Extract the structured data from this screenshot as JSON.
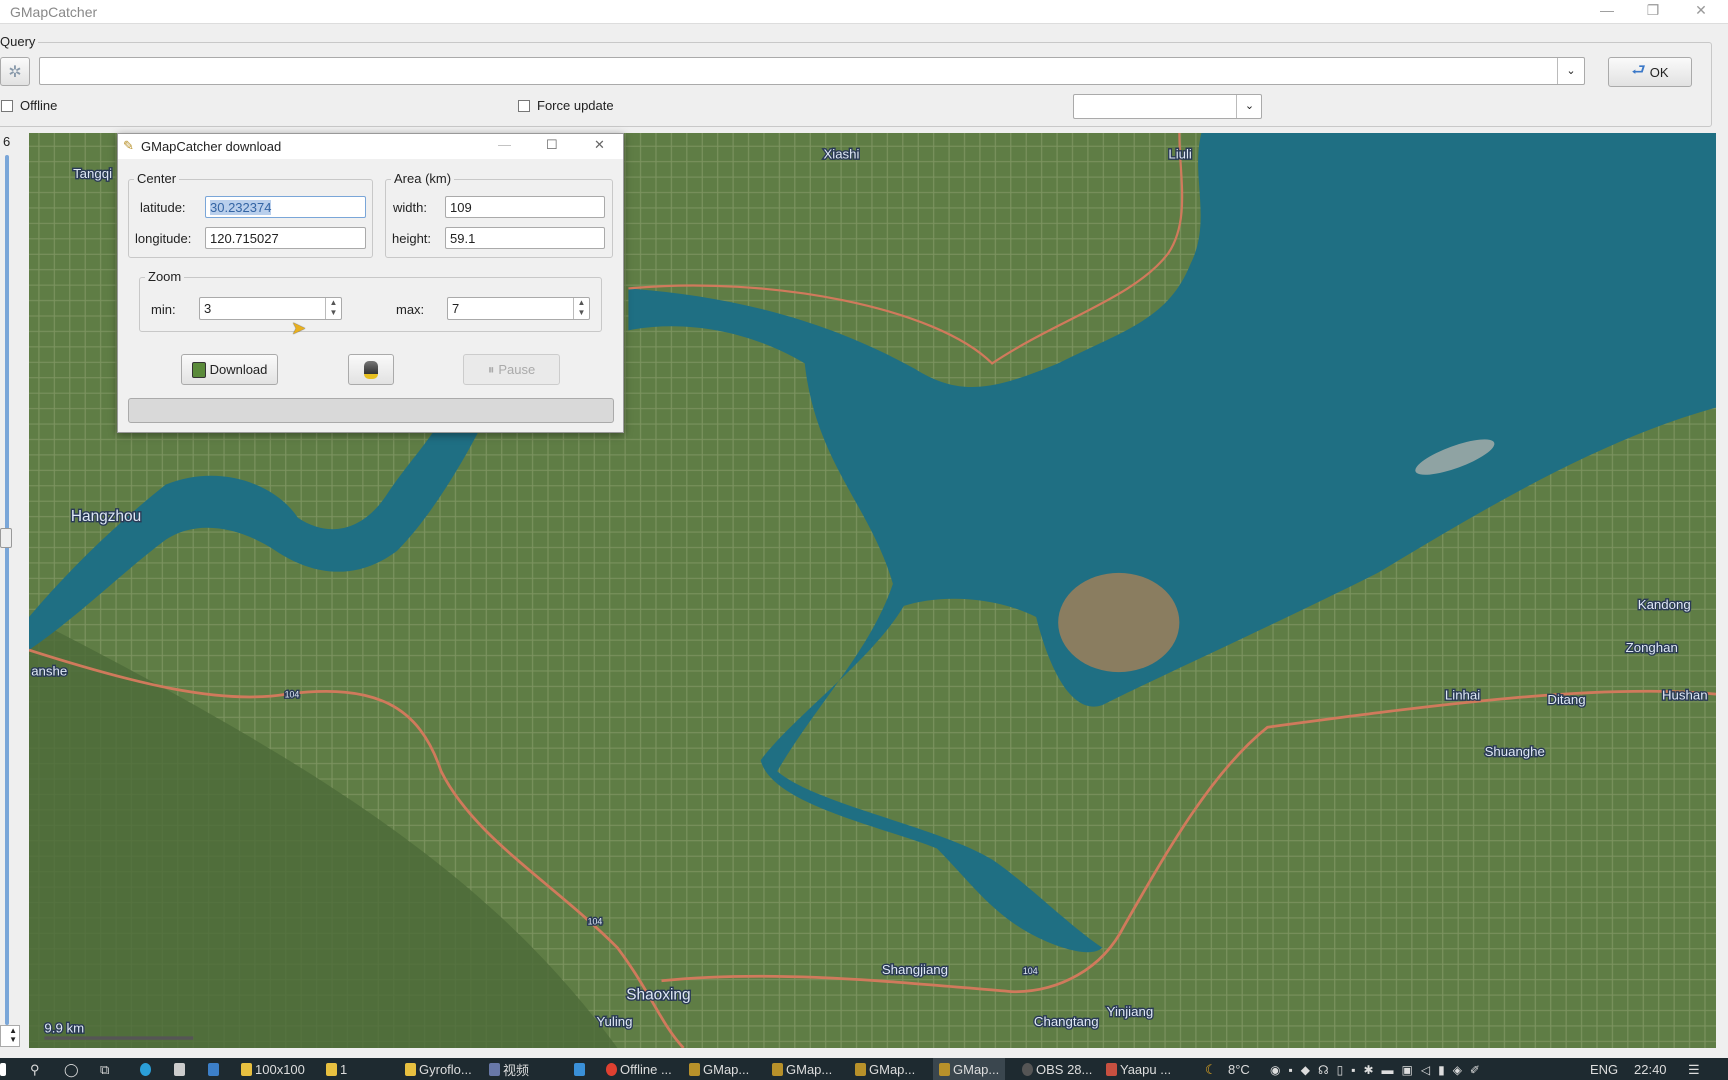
{
  "window": {
    "title": "GMapCatcher",
    "controls": [
      "minimize",
      "restore",
      "close"
    ]
  },
  "query": {
    "label": "Query",
    "value": "",
    "ok_label": "OK",
    "offline_label": "Offline",
    "offline_checked": false,
    "force_update_label": "Force update",
    "force_update_checked": false,
    "combo_value": ""
  },
  "zoom_slider": {
    "value": "6"
  },
  "map": {
    "labels": [
      "Tangqi",
      "Xiashi",
      "Liuli",
      "Hangzhou",
      "anshe",
      "Kandong",
      "Zonghan",
      "Linhai",
      "Ditang",
      "Hushan",
      "Shuanghe",
      "Shangjiang",
      "Shaoxing",
      "Yuling",
      "Changtang",
      "Yinjiang"
    ],
    "road_labels": [
      "104",
      "104",
      "104"
    ],
    "scale": "9.9 km"
  },
  "dialog": {
    "title": "GMapCatcher download",
    "center": {
      "label": "Center",
      "latitude_label": "latitude:",
      "latitude": "30.232374",
      "longitude_label": "longitude:",
      "longitude": "120.715027"
    },
    "area": {
      "label": "Area (km)",
      "width_label": "width:",
      "width": "109",
      "height_label": "height:",
      "height": "59.1"
    },
    "zoom": {
      "label": "Zoom",
      "min_label": "min:",
      "min": "3",
      "max_label": "max:",
      "max": "7"
    },
    "download_label": "Download",
    "pause_label": "Pause",
    "progress": 0
  },
  "taskbar": {
    "items": [
      "100x100",
      "1",
      "Gyroflo...",
      "视频",
      "Offline ...",
      "GMap...",
      "GMap...",
      "GMap...",
      "GMap...",
      "OBS 28...",
      "Yaapu ..."
    ],
    "weather": "8°C",
    "language": "ENG",
    "time": "22:40"
  }
}
